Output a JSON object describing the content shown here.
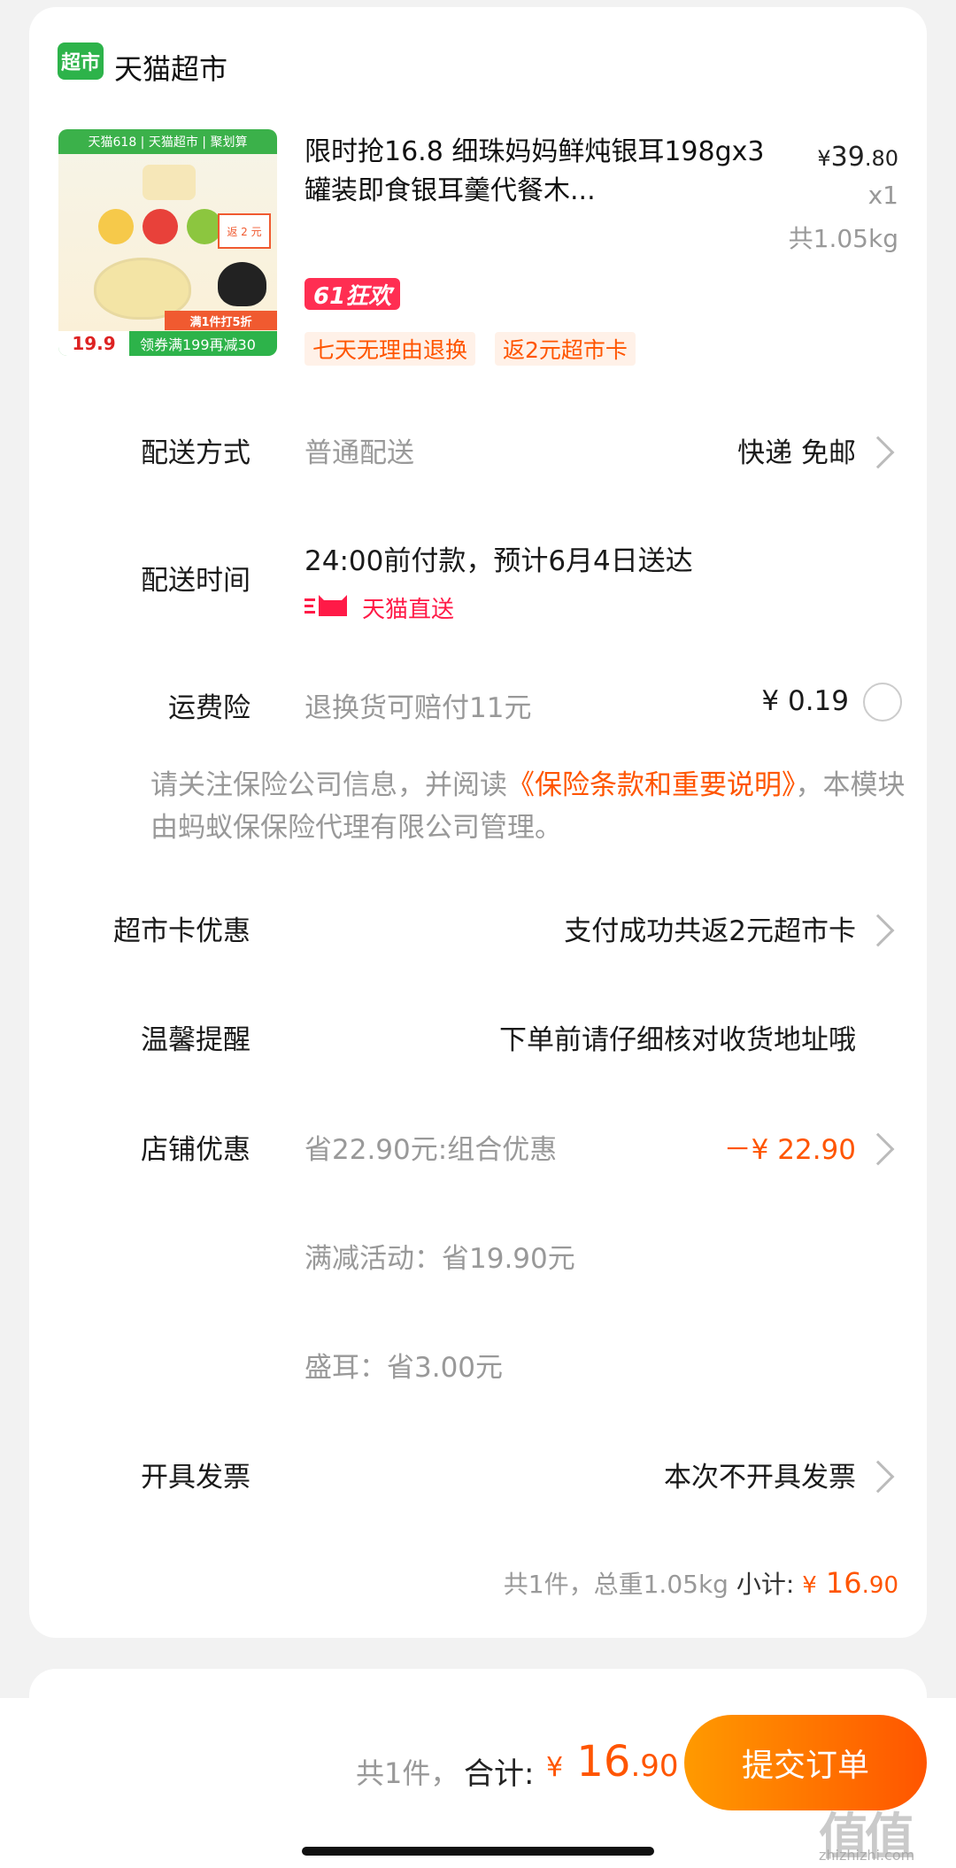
{
  "store": {
    "logo_text": "超市",
    "name": "天猫超市"
  },
  "product": {
    "title": "限时抢16.8 细珠妈妈鲜炖银耳198gx3罐装即食银耳羹代餐木...",
    "price_symbol": "¥",
    "price_int": "39",
    "price_dec": ".80",
    "qty": "x1",
    "weight": "共1.05kg",
    "promo_badge": "61狂欢",
    "tags": [
      "七天无理由退换",
      "返2元超市卡"
    ],
    "thumbnail": {
      "top_text": "天猫618 | 天猫超市 | 聚划算",
      "ribbon": "满1件打5折",
      "bottom_price": "19.9",
      "bottom_text": "领券满199再减30",
      "return_text": "返 2 元"
    }
  },
  "rows": {
    "delivery_method": {
      "label": "配送方式",
      "value": "普通配送",
      "right": "快递 免邮"
    },
    "delivery_time": {
      "label": "配送时间",
      "value": "24:00前付款，预计6月4日送达",
      "badge": "天猫直送"
    },
    "shipping_insurance": {
      "label": "运费险",
      "value": "退换货可赔付11元",
      "price": "¥ 0.19"
    },
    "notice": {
      "prefix": "请关注保险公司信息，并阅读",
      "link": "《保险条款和重要说明》",
      "suffix": "，本模块由蚂蚁保保险代理有限公司管理。"
    },
    "market_card": {
      "label": "超市卡优惠",
      "right": "支付成功共返2元超市卡"
    },
    "reminder": {
      "label": "温馨提醒",
      "right": "下单前请仔细核对收货地址哦"
    },
    "store_discount": {
      "label": "店铺优惠",
      "value": "省22.90元:组合优惠",
      "right": "－¥ 22.90"
    },
    "full_reduction": {
      "value": "满减活动：省19.90元"
    },
    "shenger": {
      "value": "盛耳：省3.00元"
    },
    "invoice": {
      "label": "开具发票",
      "right": "本次不开具发票"
    }
  },
  "summary": {
    "text": "共1件，总重1.05kg",
    "subtotal_label": "小计:",
    "subtotal_symbol": "¥",
    "subtotal_int": "16",
    "subtotal_dec": ".90"
  },
  "bottom_bar": {
    "count": "共1件，",
    "total_label": "合计:",
    "total_symbol": "¥",
    "total_int": "16",
    "total_dec": ".90",
    "submit_label": "提交订单"
  },
  "watermark": {
    "text": "值值值",
    "sub": "zhizhizhi.com"
  }
}
